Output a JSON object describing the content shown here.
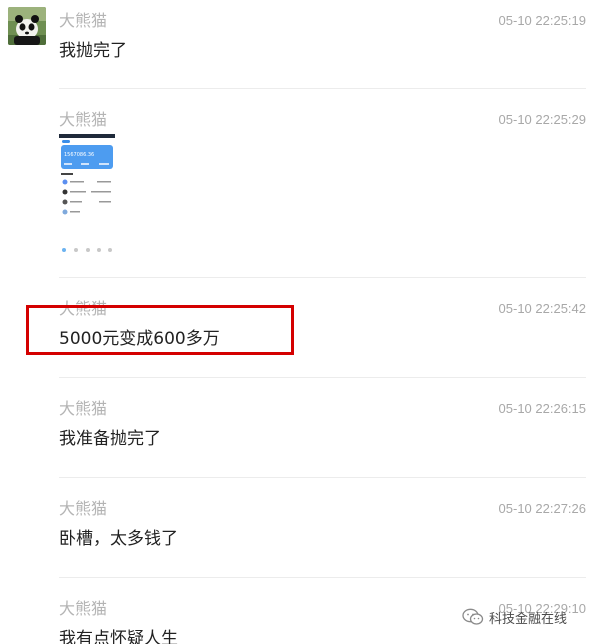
{
  "messages": [
    {
      "sender": "大熊猫",
      "time": "05-10 22:25:19",
      "text": "我抛完了"
    },
    {
      "sender": "大熊猫",
      "time": "05-10 22:25:29",
      "image_alt": "app-screenshot-thumbnail",
      "image_amount": "1567086.36"
    },
    {
      "sender": "大熊猫",
      "time": "05-10 22:25:42",
      "text": "5000元变成600多万",
      "highlighted": true
    },
    {
      "sender": "大熊猫",
      "time": "05-10 22:26:15",
      "text": "我准备抛完了"
    },
    {
      "sender": "大熊猫",
      "time": "05-10 22:27:26",
      "text": "卧槽，太多钱了"
    },
    {
      "sender": "大熊猫",
      "time": "05-10 22:29:10",
      "text": "我有点怀疑人生"
    }
  ],
  "watermark": {
    "text": "科技金融在线",
    "icon": "wechat-icon"
  },
  "colors": {
    "highlight_border": "#d40000",
    "sender": "#b4b4b4",
    "time": "#a8a8a8"
  }
}
